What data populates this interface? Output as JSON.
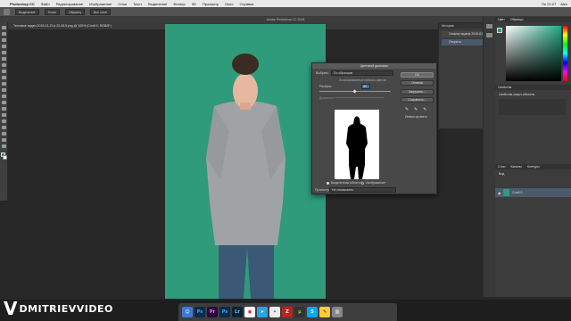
{
  "menubar": {
    "apple": "",
    "app": "Photoshop CC",
    "items": [
      "Файл",
      "Редактирование",
      "Изображение",
      "Слои",
      "Текст",
      "Выделение",
      "Фильтр",
      "3D",
      "Просмотр",
      "Окно",
      "Справка"
    ],
    "clock": "Пн 21:27",
    "user": "Alex"
  },
  "optbar": {
    "sel1": "Выделение",
    "sel2": "Тотал",
    "sel3": "Образец",
    "sel4": "Все слои"
  },
  "window_title": "Adobe Photoshop CC 2018",
  "doc_tab": "Тестовое видео 2019-01-21 в 20.45.5.png @ 100% (Слой 0, RGB/8*)",
  "dialog": {
    "title": "Цветовой диапазон",
    "select_label": "Выбрать:",
    "select_value": "По образцам",
    "localized_label": "Локализованные наборы цветов",
    "fuzziness_label": "Разброс:",
    "fuzziness_value": "40",
    "range_label": "Диапазон:",
    "ok": "OK",
    "cancel": "Отмена",
    "load": "Загрузить...",
    "save": "Сохранить...",
    "invert": "Инвертировать",
    "radio_selection": "Выделенная область",
    "radio_image": "Изображение",
    "preview_label": "Просмотр:",
    "preview_value": "Не показывать"
  },
  "history": {
    "title": "История",
    "items": [
      "Снимок экрана 2019-01-21 в 20.45",
      "Открыть"
    ]
  },
  "panels": {
    "color_tab": "Цвет",
    "swatches_tab": "Образцы",
    "props_tab": "Свойства",
    "props_title": "Свойства смарт-объекта",
    "layers_tab": "Слои",
    "channels_tab": "Каналы",
    "paths_tab": "Контуры",
    "layer_name": "Слой 0",
    "kind": "Вид"
  },
  "colors": {
    "green": "#2e9a7a",
    "panel": "#3c3c3c",
    "dialog": "#484848"
  },
  "watermark": {
    "logo": "V",
    "text": "DMITRIEVVIDEO"
  },
  "dock": {
    "icons": [
      "finder-icon",
      "photoshop-icon",
      "premiere-icon",
      "photoshop2-icon",
      "lightroom-icon",
      "chrome-icon",
      "telegram-icon",
      "safari-icon",
      "filezilla-icon",
      "torrent-icon",
      "skype-icon",
      "notes-icon",
      "trash-icon"
    ]
  }
}
